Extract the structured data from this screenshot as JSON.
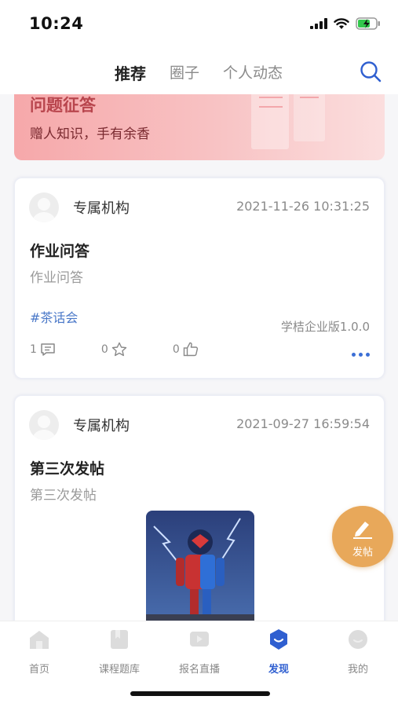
{
  "status_bar": {
    "time": "10:24"
  },
  "top_nav": {
    "tabs": [
      {
        "label": "推荐",
        "active": true
      },
      {
        "label": "圈子",
        "active": false
      },
      {
        "label": "个人动态",
        "active": false
      }
    ],
    "search_icon": "search-icon"
  },
  "banner": {
    "title": "问题征答",
    "subtitle": "赠人知识，手有余香"
  },
  "posts": [
    {
      "author": "专属机构",
      "time": "2021-11-26 10:31:25",
      "title": "作业问答",
      "body": "作业问答",
      "tag": "#茶话会",
      "source": "学桔企业版1.0.0",
      "comments": "1",
      "favorites": "0",
      "likes": "0"
    },
    {
      "author": "专属机构",
      "time": "2021-09-27 16:59:54",
      "title": "第三次发帖",
      "body": "第三次发帖"
    }
  ],
  "fab": {
    "label": "发帖"
  },
  "tab_bar": {
    "items": [
      {
        "label": "首页",
        "icon": "home-icon"
      },
      {
        "label": "课程题库",
        "icon": "course-bank-icon"
      },
      {
        "label": "报名直播",
        "icon": "live-icon"
      },
      {
        "label": "发现",
        "icon": "discover-icon",
        "active": true
      },
      {
        "label": "我的",
        "icon": "profile-icon"
      }
    ]
  },
  "colors": {
    "accent": "#2f5fd0",
    "tag": "#4a78c8",
    "fab": "#e8a85a",
    "banner_title": "#b8454d"
  }
}
